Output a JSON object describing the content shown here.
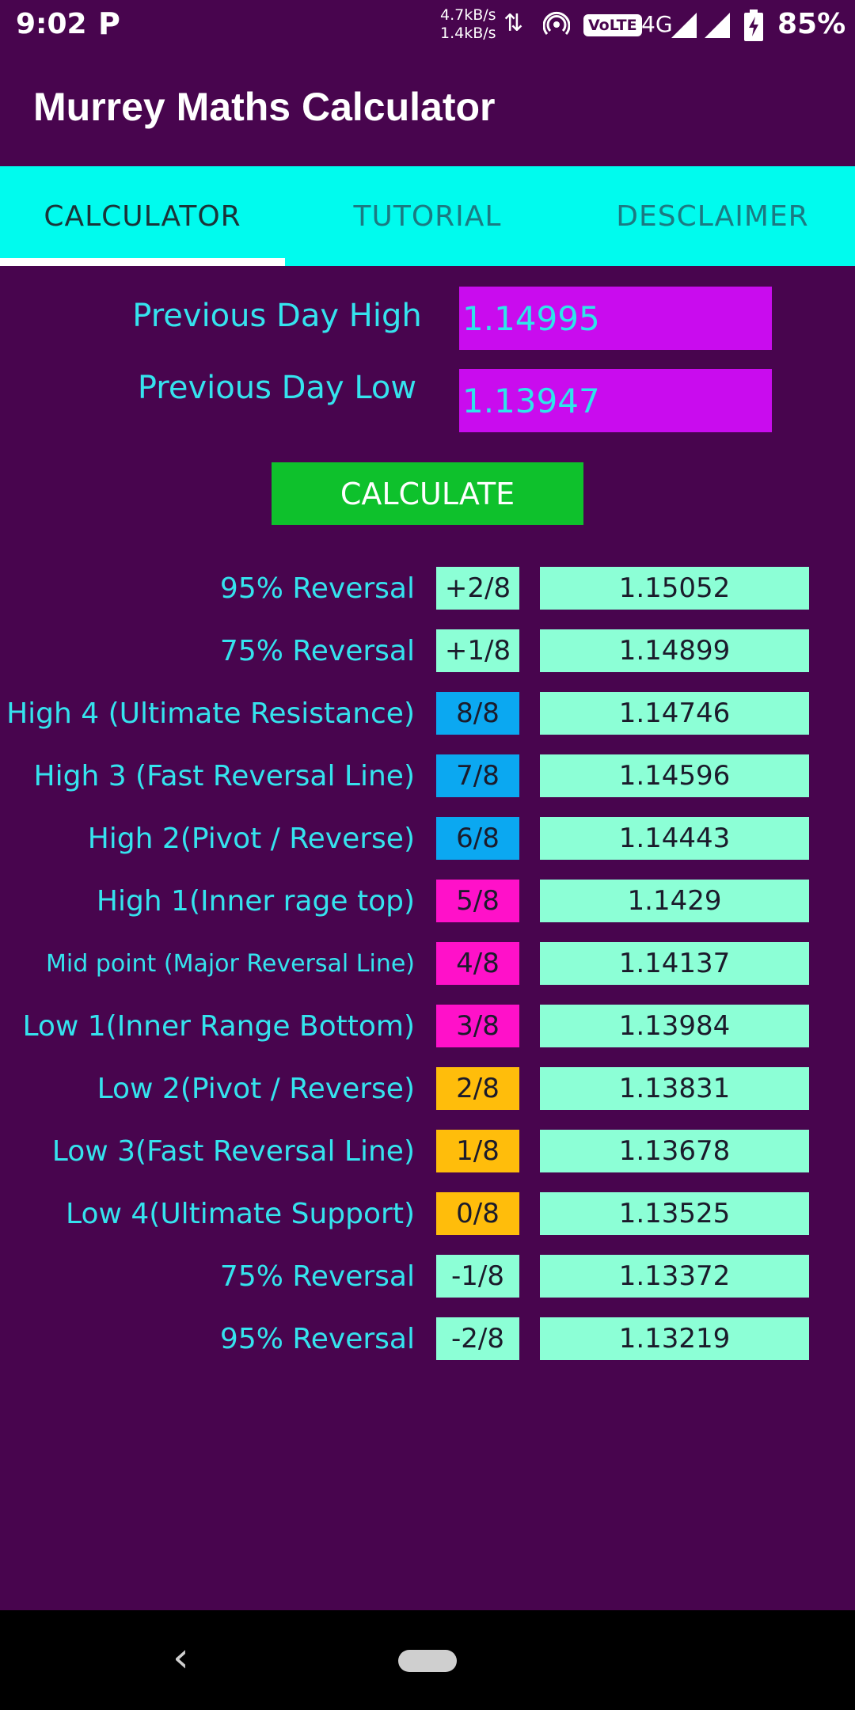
{
  "status": {
    "time": "9:02",
    "notification_icon": "P",
    "speed_up": "4.7kB/s",
    "speed_down": "1.4kB/s",
    "volte": "VoLTE",
    "network": "4G",
    "battery": "85%"
  },
  "app": {
    "title": "Murrey Maths Calculator"
  },
  "tabs": [
    {
      "label": "CALCULATOR",
      "active": true
    },
    {
      "label": "TUTORIAL",
      "active": false
    },
    {
      "label": "DESCLAIMER",
      "active": false
    }
  ],
  "inputs": {
    "high_label": "Previous Day High",
    "high_value": "1.14995",
    "low_label": "Previous Day Low",
    "low_value": "1.13947"
  },
  "calculate_label": "CALCULATE",
  "colors": {
    "background": "#48054e",
    "tab_bar": "#00fbee",
    "input_bg": "#c90cee",
    "button_bg": "#0ec12c",
    "value_bg": "#8cffd6",
    "label_text": "#35e3ee"
  },
  "results": [
    {
      "label": "95% Reversal",
      "fraction": "+2/8",
      "value": "1.15052",
      "color": "#8cffd6"
    },
    {
      "label": "75% Reversal",
      "fraction": "+1/8",
      "value": "1.14899",
      "color": "#8cffd6"
    },
    {
      "label": "High 4 (Ultimate Resistance)",
      "fraction": "8/8",
      "value": "1.14746",
      "color": "#0ba8f1"
    },
    {
      "label": "High 3 (Fast Reversal Line)",
      "fraction": "7/8",
      "value": "1.14596",
      "color": "#0ba8f1"
    },
    {
      "label": "High 2(Pivot / Reverse)",
      "fraction": "6/8",
      "value": "1.14443",
      "color": "#0ba8f1"
    },
    {
      "label": "High 1(Inner rage top)",
      "fraction": "5/8",
      "value": "1.1429",
      "color": "#ff11c9"
    },
    {
      "label": "Mid point (Major Reversal Line)",
      "fraction": "4/8",
      "value": "1.14137",
      "color": "#ff11c9"
    },
    {
      "label": "Low 1(Inner Range Bottom)",
      "fraction": "3/8",
      "value": "1.13984",
      "color": "#ff11c9"
    },
    {
      "label": "Low 2(Pivot / Reverse)",
      "fraction": "2/8",
      "value": "1.13831",
      "color": "#ffbd0b"
    },
    {
      "label": "Low 3(Fast Reversal Line)",
      "fraction": "1/8",
      "value": "1.13678",
      "color": "#ffbd0b"
    },
    {
      "label": "Low 4(Ultimate Support)",
      "fraction": "0/8",
      "value": "1.13525",
      "color": "#ffbd0b"
    },
    {
      "label": "75% Reversal",
      "fraction": "-1/8",
      "value": "1.13372",
      "color": "#8cffd6"
    },
    {
      "label": "95% Reversal",
      "fraction": "-2/8",
      "value": "1.13219",
      "color": "#8cffd6"
    }
  ]
}
